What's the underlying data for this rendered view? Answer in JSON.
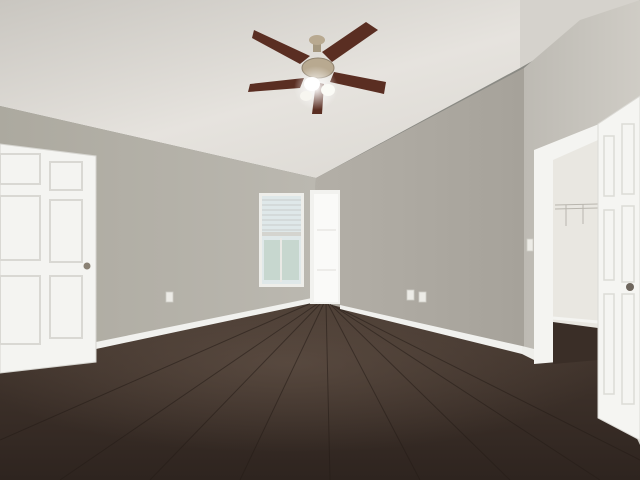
{
  "scene": {
    "subject": "empty-bedroom-interior",
    "elements": [
      "ceiling-fan-with-light",
      "textured-ceiling",
      "left-white-panel-door",
      "window-with-blinds",
      "hallway-door",
      "closet-doorway-with-wire-shelf",
      "open-white-door-right",
      "dark-wood-laminate-floor",
      "white-baseboards",
      "wall-outlets",
      "light-switch"
    ],
    "colors": {
      "ceiling": "#e6e3de",
      "left_wall": "#b5b2aa",
      "back_wall": "#aeaaa2",
      "right_wall": "#c4c1ba",
      "floor": "#3c2f28",
      "floor_dark": "#2a211c",
      "trim": "#f4f4f1",
      "fan_blade": "#5a2e22",
      "fan_metal": "#b8a990",
      "window_light": "#dfe8e9",
      "closet_wall": "#e9e7e1"
    }
  }
}
